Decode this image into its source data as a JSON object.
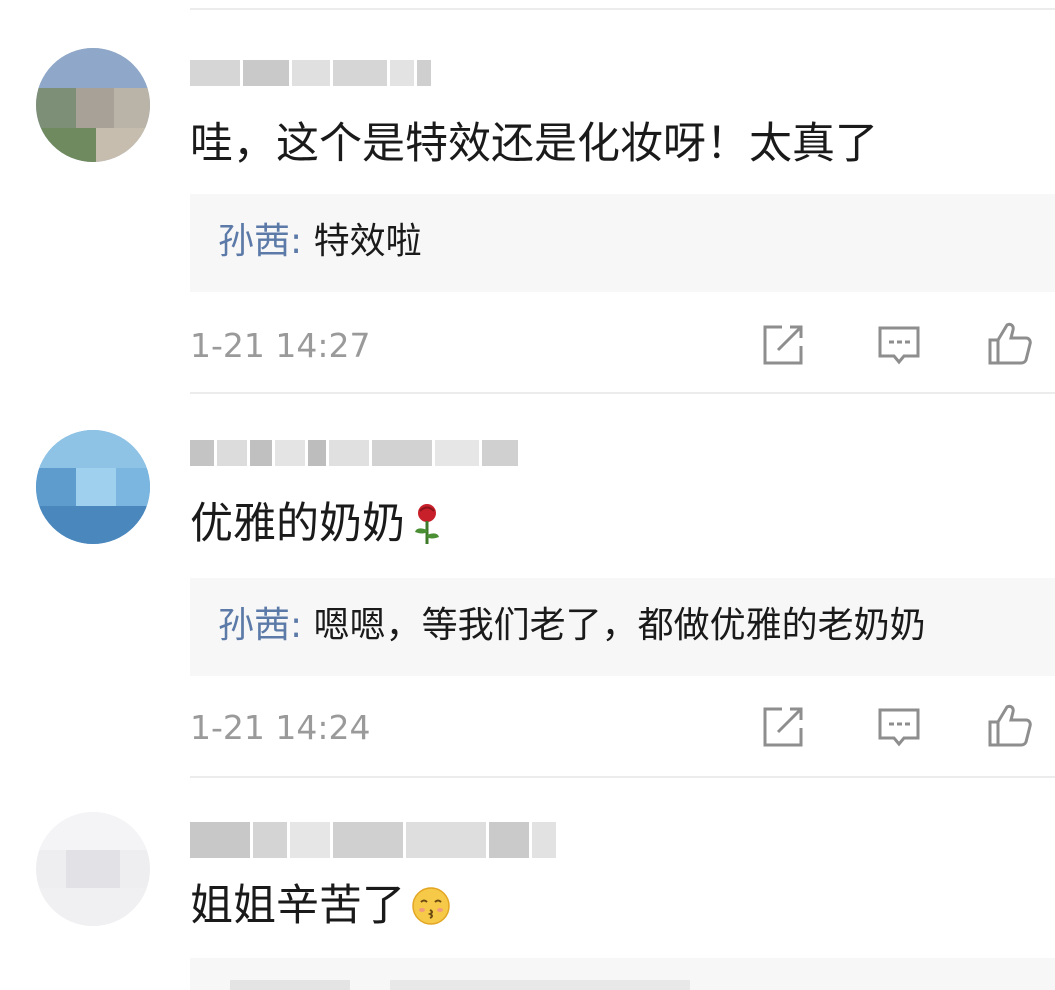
{
  "comments": [
    {
      "text": "哇，这个是特效还是化妆呀！太真了",
      "reply": {
        "author": "孙茜",
        "colon": ":",
        "text": " 特效啦"
      },
      "time": "1-21 14:27"
    },
    {
      "text": "优雅的奶奶",
      "emoji": "rose-emoji",
      "reply": {
        "author": "孙茜",
        "colon": ":",
        "text": " 嗯嗯，等我们老了，都做优雅的老奶奶"
      },
      "time": "1-21 14:24"
    },
    {
      "text": "姐姐辛苦了",
      "emoji": "kissing-face-emoji"
    }
  ],
  "actions": [
    "share-icon",
    "comment-icon",
    "like-icon"
  ],
  "colors": {
    "reply_author": "#5b7aa8",
    "timestamp": "#9a9a9a",
    "reply_bg": "#f7f7f7",
    "text": "#1a1a1a"
  }
}
